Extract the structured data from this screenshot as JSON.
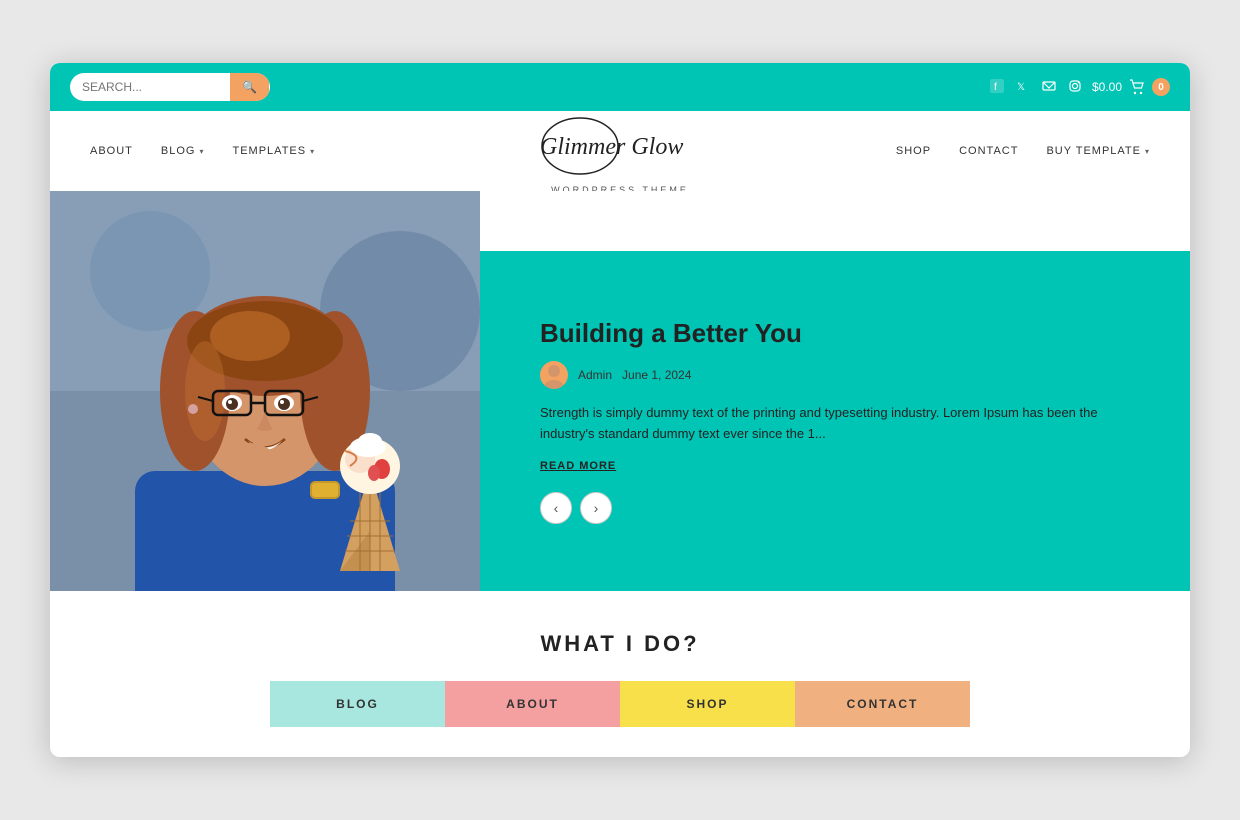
{
  "topbar": {
    "search_placeholder": "SEARCH...",
    "search_btn_icon": "🔍",
    "social": {
      "facebook": "f",
      "twitter": "t",
      "email": "✉",
      "instagram": "📷"
    },
    "cart_price": "$0.00",
    "cart_count": "0"
  },
  "nav": {
    "left_items": [
      {
        "label": "ABOUT",
        "has_chevron": false
      },
      {
        "label": "BLOG",
        "has_chevron": true
      },
      {
        "label": "TEMPLATES",
        "has_chevron": true
      }
    ],
    "logo_title": "Glimmer Glow",
    "logo_subtitle": "WORDPRESS THEME",
    "right_items": [
      {
        "label": "SHOP",
        "has_chevron": false
      },
      {
        "label": "CONTACT",
        "has_chevron": false
      },
      {
        "label": "BUY TEMPLATE",
        "has_chevron": true
      }
    ]
  },
  "hero": {
    "post_title": "Building a Better You",
    "post_author": "Admin",
    "post_date": "June 1, 2024",
    "post_excerpt": "Strength is simply dummy text of the printing and typesetting industry. Lorem Ipsum has been the industry's standard dummy text ever since the 1...",
    "read_more_label": "READ MORE",
    "prev_icon": "‹",
    "next_icon": "›"
  },
  "what_section": {
    "title": "WHAT I DO?",
    "buttons": [
      {
        "label": "BLOG",
        "class": "blog"
      },
      {
        "label": "ABOUT",
        "class": "about"
      },
      {
        "label": "SHOP",
        "class": "shop"
      },
      {
        "label": "CONTACT",
        "class": "contact"
      }
    ]
  }
}
